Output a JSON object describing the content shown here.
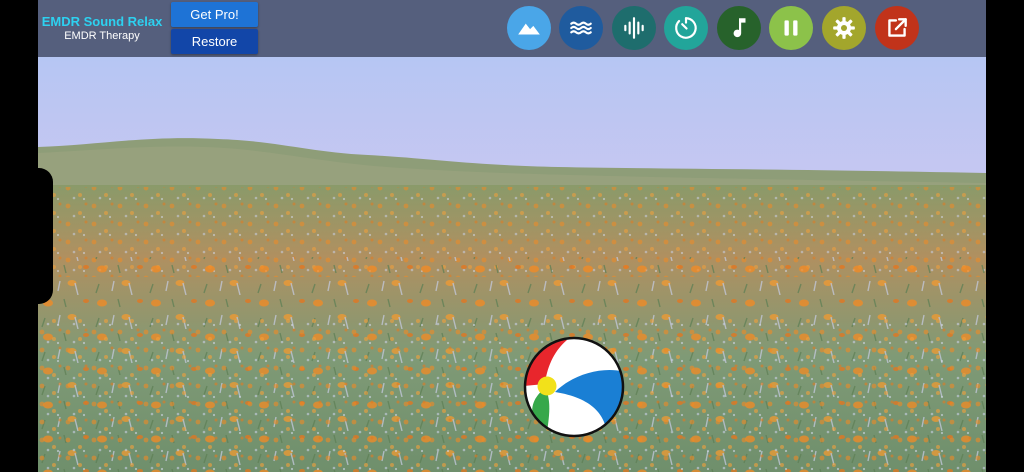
{
  "app": {
    "title": "EMDR Sound Relax",
    "subtitle": "EMDR Therapy"
  },
  "buttons": {
    "get_pro": "Get Pro!",
    "restore": "Restore"
  },
  "controls": [
    {
      "name": "scenery-button",
      "icon": "mountain-icon",
      "color": "#4aa6e8"
    },
    {
      "name": "waves-button",
      "icon": "waves-icon",
      "color": "#1f5b9e"
    },
    {
      "name": "sound-button",
      "icon": "sound-wave-icon",
      "color": "#1e6d6d"
    },
    {
      "name": "timer-button",
      "icon": "timer-icon",
      "color": "#22a59a"
    },
    {
      "name": "music-button",
      "icon": "music-note-icon",
      "color": "#27622b"
    },
    {
      "name": "pause-button",
      "icon": "pause-icon",
      "color": "#8cc24a"
    },
    {
      "name": "settings-button",
      "icon": "gear-icon",
      "color": "#a3a62c"
    },
    {
      "name": "share-button",
      "icon": "external-link-icon",
      "color": "#c1331a"
    }
  ],
  "scene": {
    "type": "flower-field",
    "sky_top": "#b7c7f2",
    "sky_bottom": "#e8c8ec",
    "ball_colors": [
      "#e8262c",
      "#1a7fd4",
      "#36a84a",
      "#f2e11a",
      "#ffffff"
    ]
  }
}
